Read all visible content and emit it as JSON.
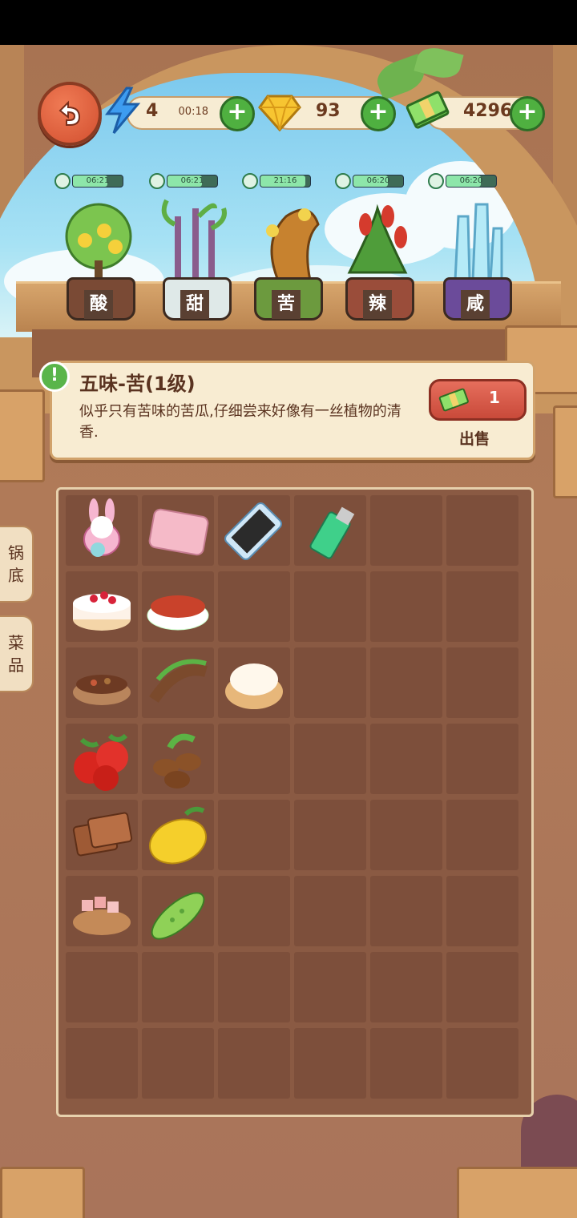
{
  "hud": {
    "energy": {
      "value": "4",
      "timer": "00:18",
      "icon": "lightning-icon"
    },
    "gems": {
      "value": "93",
      "icon": "gem-icon"
    },
    "cash": {
      "value": "4296",
      "icon": "cash-icon"
    }
  },
  "plants": [
    {
      "label": "酸",
      "timer": "06:21",
      "progress": 0.7,
      "pot_color": "#7a4a35"
    },
    {
      "label": "甜",
      "timer": "06:21",
      "progress": 0.7,
      "pot_color": "#dfe9e8"
    },
    {
      "label": "苦",
      "timer": "21:16",
      "progress": 0.9,
      "pot_color": "#6c9a3e"
    },
    {
      "label": "辣",
      "timer": "06:20",
      "progress": 0.7,
      "pot_color": "#9a4d3a"
    },
    {
      "label": "咸",
      "timer": "06:20",
      "progress": 0.7,
      "pot_color": "#6b4b9a"
    }
  ],
  "info": {
    "badge": "!",
    "title": "五味-苦(1级)",
    "description": "似乎只有苦味的苦瓜,仔细尝来好像有一丝植物的清香.",
    "sell_price": "1",
    "sell_label": "出售"
  },
  "side_tabs": [
    {
      "label": "锅底"
    },
    {
      "label": "菜品"
    }
  ],
  "inventory": {
    "rows": 8,
    "cols": 6,
    "items": [
      [
        {
          "name": "bunny-plush"
        },
        {
          "name": "pink-wallet"
        },
        {
          "name": "smartphone"
        },
        {
          "name": "green-lighter"
        }
      ],
      [
        {
          "name": "strawberry-cake"
        },
        {
          "name": "chili-powder-bowl"
        }
      ],
      [
        {
          "name": "spice-mix-bowl"
        },
        {
          "name": "tamarind"
        },
        {
          "name": "cream-puff"
        }
      ],
      [
        {
          "name": "hawthorn-berries"
        },
        {
          "name": "coffee-beans"
        }
      ],
      [
        {
          "name": "brown-sugar-blocks"
        },
        {
          "name": "lemon"
        }
      ],
      [
        {
          "name": "rock-salt-bowl"
        },
        {
          "name": "bitter-melon"
        }
      ]
    ]
  }
}
